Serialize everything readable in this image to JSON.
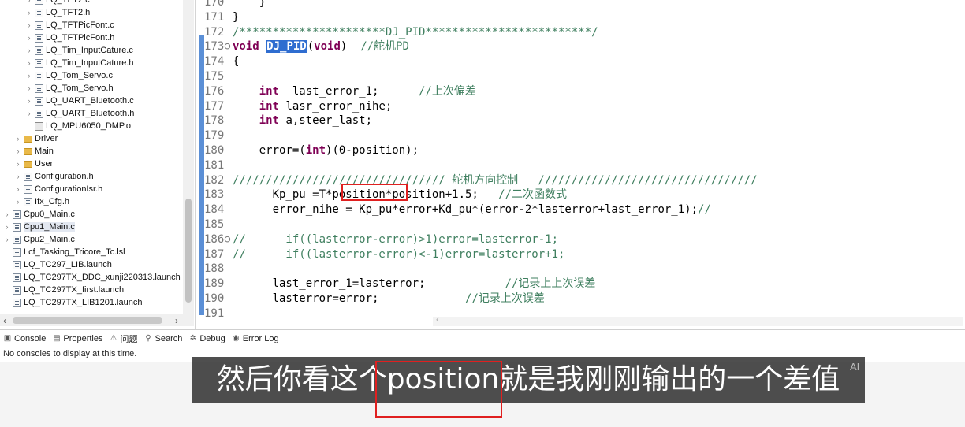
{
  "explorer": {
    "items": [
      {
        "indent": 3,
        "chev": "›",
        "icon": "file",
        "label": "LQ_TFT2.c"
      },
      {
        "indent": 3,
        "chev": "›",
        "icon": "file",
        "label": "LQ_TFT2.h"
      },
      {
        "indent": 3,
        "chev": "›",
        "icon": "file",
        "label": "LQ_TFTPicFont.c"
      },
      {
        "indent": 3,
        "chev": "›",
        "icon": "file",
        "label": "LQ_TFTPicFont.h"
      },
      {
        "indent": 3,
        "chev": "›",
        "icon": "file",
        "label": "LQ_Tim_InputCature.c"
      },
      {
        "indent": 3,
        "chev": "›",
        "icon": "file",
        "label": "LQ_Tim_InputCature.h"
      },
      {
        "indent": 3,
        "chev": "›",
        "icon": "file",
        "label": "LQ_Tom_Servo.c"
      },
      {
        "indent": 3,
        "chev": "›",
        "icon": "file",
        "label": "LQ_Tom_Servo.h"
      },
      {
        "indent": 3,
        "chev": "›",
        "icon": "file",
        "label": "LQ_UART_Bluetooth.c"
      },
      {
        "indent": 3,
        "chev": "›",
        "icon": "file",
        "label": "LQ_UART_Bluetooth.h"
      },
      {
        "indent": 3,
        "chev": "",
        "icon": "obj",
        "label": "LQ_MPU6050_DMP.o"
      },
      {
        "indent": 2,
        "chev": "›",
        "icon": "folder",
        "label": "Driver"
      },
      {
        "indent": 2,
        "chev": "›",
        "icon": "folder",
        "label": "Main"
      },
      {
        "indent": 2,
        "chev": "›",
        "icon": "folder",
        "label": "User"
      },
      {
        "indent": 2,
        "chev": "›",
        "icon": "file",
        "label": "Configuration.h"
      },
      {
        "indent": 2,
        "chev": "›",
        "icon": "file",
        "label": "ConfigurationIsr.h"
      },
      {
        "indent": 2,
        "chev": "›",
        "icon": "file",
        "label": "Ifx_Cfg.h"
      },
      {
        "indent": 1,
        "chev": "›",
        "icon": "file",
        "label": "Cpu0_Main.c"
      },
      {
        "indent": 1,
        "chev": "›",
        "icon": "file",
        "label": "Cpu1_Main.c",
        "selected": true
      },
      {
        "indent": 1,
        "chev": "›",
        "icon": "file",
        "label": "Cpu2_Main.c"
      },
      {
        "indent": 1,
        "chev": "",
        "icon": "file",
        "label": "Lcf_Tasking_Tricore_Tc.lsl"
      },
      {
        "indent": 1,
        "chev": "",
        "icon": "file",
        "label": "LQ_TC297_LIB.launch"
      },
      {
        "indent": 1,
        "chev": "",
        "icon": "file",
        "label": "LQ_TC297TX_DDC_xunji220313.launch"
      },
      {
        "indent": 1,
        "chev": "",
        "icon": "file",
        "label": "LQ_TC297TX_first.launch"
      },
      {
        "indent": 1,
        "chev": "",
        "icon": "file",
        "label": "LQ_TC297TX_LIB1201.launch"
      }
    ],
    "scroll_left_arrow": "‹",
    "scroll_right_arrow": "›"
  },
  "editor": {
    "lines": [
      {
        "ln": "170",
        "tokens": [
          {
            "t": "    }",
            "c": ""
          }
        ]
      },
      {
        "ln": "171",
        "tokens": [
          {
            "t": "}",
            "c": ""
          }
        ]
      },
      {
        "ln": "172",
        "tokens": [
          {
            "t": "/**********************DJ_PID*************************/",
            "c": "cm"
          }
        ]
      },
      {
        "ln": "173⊖",
        "tokens": [
          {
            "t": "void",
            "c": "kw"
          },
          {
            "t": " ",
            "c": ""
          },
          {
            "t": "DJ_PID",
            "c": "fn"
          },
          {
            "t": "(",
            "c": ""
          },
          {
            "t": "void",
            "c": "kw"
          },
          {
            "t": ")  ",
            "c": ""
          },
          {
            "t": "//舵机PD",
            "c": "cm"
          }
        ]
      },
      {
        "ln": "174",
        "tokens": [
          {
            "t": "{",
            "c": ""
          }
        ]
      },
      {
        "ln": "175",
        "tokens": [
          {
            "t": "",
            "c": ""
          }
        ]
      },
      {
        "ln": "176",
        "tokens": [
          {
            "t": "    ",
            "c": ""
          },
          {
            "t": "int",
            "c": "kw"
          },
          {
            "t": "  last_error_1;      ",
            "c": ""
          },
          {
            "t": "//上次偏差",
            "c": "cm"
          }
        ]
      },
      {
        "ln": "177",
        "tokens": [
          {
            "t": "    ",
            "c": ""
          },
          {
            "t": "int",
            "c": "kw"
          },
          {
            "t": " lasr_error_nihe;",
            "c": ""
          }
        ]
      },
      {
        "ln": "178",
        "tokens": [
          {
            "t": "    ",
            "c": ""
          },
          {
            "t": "int",
            "c": "kw"
          },
          {
            "t": " a,steer_last;",
            "c": ""
          }
        ]
      },
      {
        "ln": "179",
        "tokens": [
          {
            "t": "",
            "c": ""
          }
        ]
      },
      {
        "ln": "180",
        "tokens": [
          {
            "t": "    error=(",
            "c": ""
          },
          {
            "t": "int",
            "c": "kw"
          },
          {
            "t": ")(0-position);",
            "c": ""
          }
        ]
      },
      {
        "ln": "181",
        "tokens": [
          {
            "t": "",
            "c": ""
          }
        ]
      },
      {
        "ln": "182",
        "tokens": [
          {
            "t": "//////////////////////////////// 舵机方向控制   /////////////////////////////////",
            "c": "cm"
          }
        ]
      },
      {
        "ln": "183",
        "tokens": [
          {
            "t": "      Kp_pu =T*position*position+1.5;   ",
            "c": ""
          },
          {
            "t": "//二次函数式",
            "c": "cm"
          }
        ]
      },
      {
        "ln": "184",
        "tokens": [
          {
            "t": "      error_nihe = Kp_pu*error+Kd_pu*(error-2*lasterror+last_error_1);",
            "c": ""
          },
          {
            "t": "//",
            "c": "cm"
          }
        ]
      },
      {
        "ln": "185",
        "tokens": [
          {
            "t": "",
            "c": ""
          }
        ]
      },
      {
        "ln": "186⊖",
        "tokens": [
          {
            "t": "//      if((lasterror-error)>1)error=lasterror-1;",
            "c": "cm"
          }
        ]
      },
      {
        "ln": "187",
        "tokens": [
          {
            "t": "//      if((lasterror-error)<-1)error=lasterror+1;",
            "c": "cm"
          }
        ]
      },
      {
        "ln": "188",
        "tokens": [
          {
            "t": "",
            "c": ""
          }
        ]
      },
      {
        "ln": "189",
        "tokens": [
          {
            "t": "      last_error_1=lasterror;            ",
            "c": ""
          },
          {
            "t": "//记录上上次误差",
            "c": "cm"
          }
        ]
      },
      {
        "ln": "190",
        "tokens": [
          {
            "t": "      lasterror=error;             ",
            "c": ""
          },
          {
            "t": "//记录上次误差",
            "c": "cm"
          }
        ]
      },
      {
        "ln": "191",
        "tokens": [
          {
            "t": "",
            "c": ""
          }
        ]
      }
    ],
    "scroll_left_arrow": "‹"
  },
  "console": {
    "tabs": [
      {
        "name": "console",
        "icon": "▣",
        "label": "Console"
      },
      {
        "name": "properties",
        "icon": "▤",
        "label": "Properties"
      },
      {
        "name": "problems",
        "icon": "⚠",
        "label": "问题"
      },
      {
        "name": "search",
        "icon": "⚲",
        "label": "Search"
      },
      {
        "name": "debug",
        "icon": "✲",
        "label": "Debug"
      },
      {
        "name": "error-log",
        "icon": "◉",
        "label": "Error Log"
      }
    ],
    "message": "No consoles to display at this time."
  },
  "subtitle": {
    "text": "然后你看这个position就是我刚刚输出的一个差值",
    "badge": "AI"
  },
  "colors": {
    "highlight_box": "#e02020",
    "keyword": "#7f0055",
    "comment": "#3f7f5f",
    "selection": "#2f6dd0"
  }
}
